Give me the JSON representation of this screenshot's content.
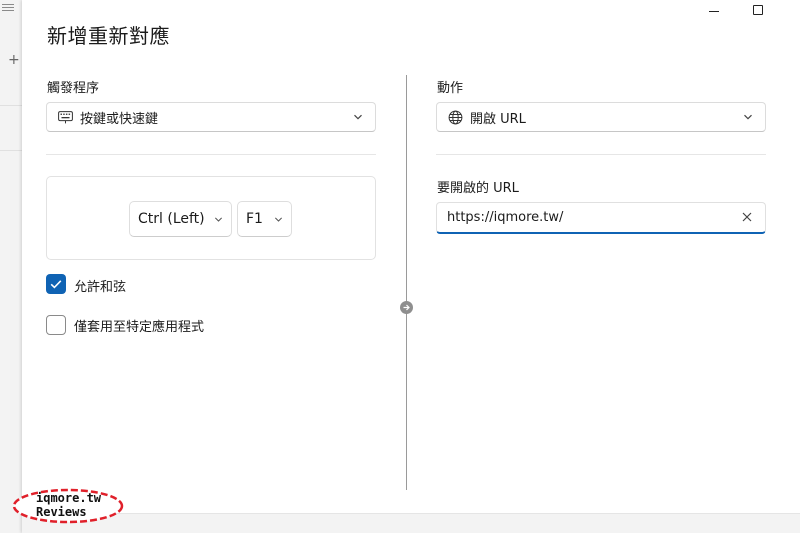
{
  "dialog": {
    "title": "新增重新對應"
  },
  "trigger": {
    "section_label": "觸發程序",
    "selected": "按鍵或快速鍵",
    "keys": [
      "Ctrl (Left)",
      "F1"
    ],
    "allow_chords_label": "允許和弦",
    "allow_chords_checked": true,
    "app_specific_label": "僅套用至特定應用程式",
    "app_specific_checked": false
  },
  "action": {
    "section_label": "動作",
    "selected": "開啟 URL",
    "url_label": "要開啟的 URL",
    "url_value": "https://iqmore.tw/"
  },
  "watermark": {
    "line1": "iqmore.tw",
    "line2": "Reviews"
  },
  "colors": {
    "accent": "#0f63b4",
    "watermark_ring": "#e0202a"
  }
}
